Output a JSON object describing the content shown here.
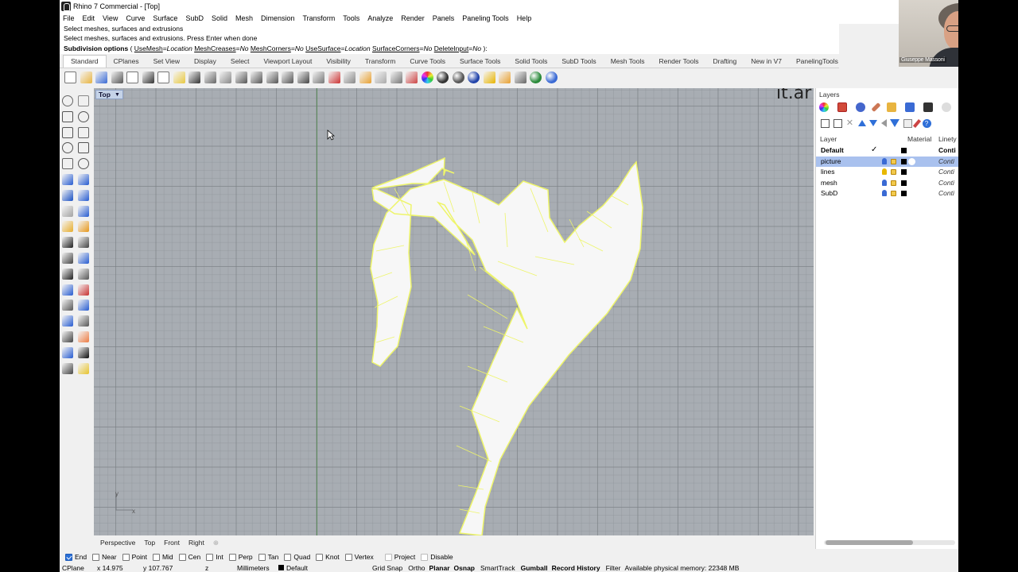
{
  "window": {
    "title": "Rhino 7 Commercial - [Top]"
  },
  "menu": [
    "File",
    "Edit",
    "View",
    "Curve",
    "Surface",
    "SubD",
    "Solid",
    "Mesh",
    "Dimension",
    "Transform",
    "Tools",
    "Analyze",
    "Render",
    "Panels",
    "Paneling Tools",
    "Help"
  ],
  "command": {
    "history": [
      "Select meshes, surfaces and extrusions",
      "Select meshes, surfaces and extrusions. Press Enter when done"
    ],
    "prompt_name": "Subdivision options",
    "paren_open": " ( ",
    "options": [
      {
        "name": "UseMesh",
        "value": "Location"
      },
      {
        "name": "MeshCreases",
        "value": "No"
      },
      {
        "name": "MeshCorners",
        "value": "No"
      },
      {
        "name": "UseSurface",
        "value": "Location"
      },
      {
        "name": "SurfaceCorners",
        "value": "No"
      },
      {
        "name": "DeleteInput",
        "value": "No"
      }
    ],
    "paren_close": " ):"
  },
  "toolbar_tabs": [
    "Standard",
    "CPlanes",
    "Set View",
    "Display",
    "Select",
    "Viewport Layout",
    "Visibility",
    "Transform",
    "Curve Tools",
    "Surface Tools",
    "Solid Tools",
    "SubD Tools",
    "Mesh Tools",
    "Render Tools",
    "Drafting",
    "New in V7",
    "PanelingTools"
  ],
  "active_tab": "Standard",
  "standard_icons": [
    "new-icon",
    "open-icon",
    "save-icon",
    "print-icon",
    "import-icon",
    "cut-icon",
    "copy-icon",
    "paste-icon",
    "undo-icon",
    "pan-icon",
    "move-view-icon",
    "zoom-icon",
    "zoom-window-icon",
    "zoom-extents-icon",
    "zoom-selected-icon",
    "rotate-view-icon",
    "grid-icon",
    "car-icon",
    "camera-icon",
    "dims-icon",
    "bulb-icon",
    "lock-icon",
    "layer-icon",
    "color-wheel-icon",
    "shade-icon",
    "render-icon",
    "sphere-icon",
    "light-icon",
    "settings-icon",
    "select-filter-icon",
    "globe-icon",
    "help-icon"
  ],
  "viewport": {
    "name": "Top",
    "watermark": "it.ar",
    "axis_x": "x",
    "axis_y": "y"
  },
  "viewport_tabs": [
    "Perspective",
    "Top",
    "Front",
    "Right"
  ],
  "osnaps": [
    {
      "label": "End",
      "checked": true
    },
    {
      "label": "Near",
      "checked": false
    },
    {
      "label": "Point",
      "checked": false
    },
    {
      "label": "Mid",
      "checked": false
    },
    {
      "label": "Cen",
      "checked": false
    },
    {
      "label": "Int",
      "checked": false
    },
    {
      "label": "Perp",
      "checked": false
    },
    {
      "label": "Tan",
      "checked": false
    },
    {
      "label": "Quad",
      "checked": false
    },
    {
      "label": "Knot",
      "checked": false
    },
    {
      "label": "Vertex",
      "checked": false
    },
    {
      "label": "Project",
      "checked": false
    },
    {
      "label": "Disable",
      "checked": false
    }
  ],
  "status": {
    "cplane": "CPlane",
    "x": "x 14.975",
    "y": "y 107.767",
    "z": "z",
    "units": "Millimeters",
    "layer": "Default",
    "grid_snap": "Grid Snap",
    "ortho": "Ortho",
    "planar": "Planar",
    "osnap": "Osnap",
    "smarttrack": "SmartTrack",
    "gumball": "Gumball",
    "record_history": "Record History",
    "filter": "Filter",
    "memory": "Available physical memory: 22348 MB"
  },
  "layers_panel": {
    "title": "Layers",
    "col_layer": "Layer",
    "col_material": "Material",
    "col_linetype": "Linety",
    "rows": [
      {
        "name": "Default",
        "current": true,
        "linetype": "Conti",
        "bulb_color": "#000000",
        "selected": false
      },
      {
        "name": "picture",
        "current": false,
        "linetype": "Conti",
        "bulb_color": "#3a6ad4",
        "selected": true
      },
      {
        "name": "lines",
        "current": false,
        "linetype": "Conti",
        "bulb_color": "#e8b800",
        "selected": false
      },
      {
        "name": "mesh",
        "current": false,
        "linetype": "Conti",
        "bulb_color": "#3a6ad4",
        "selected": false
      },
      {
        "name": "SubD",
        "current": false,
        "linetype": "Conti",
        "bulb_color": "#3a6ad4",
        "selected": false
      }
    ],
    "check_glyph": "✓"
  },
  "webcam": {
    "name": "Giuseppe Massoni"
  }
}
